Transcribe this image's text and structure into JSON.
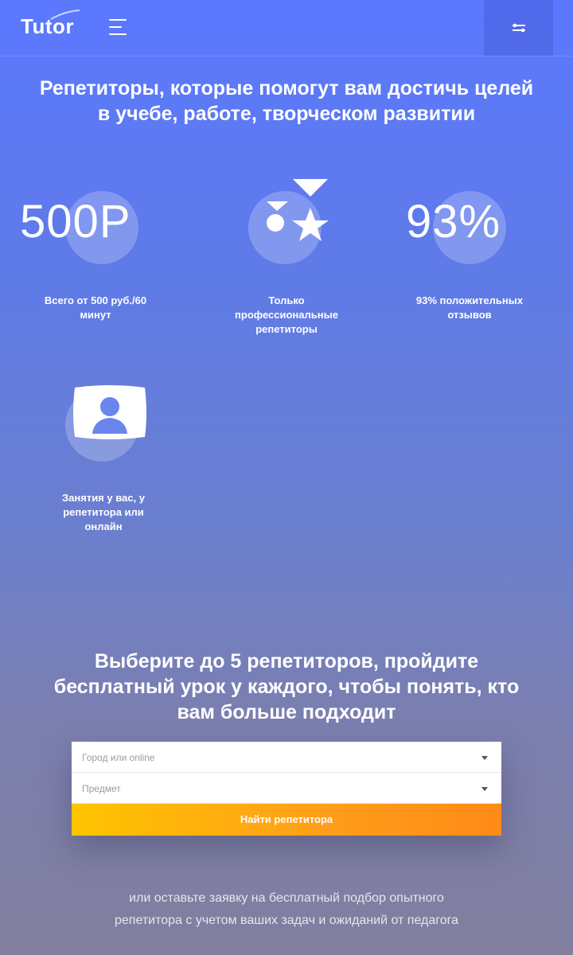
{
  "header": {
    "logo": "Tutor",
    "menu_icon": "hamburger-menu-icon",
    "filter_icon": "filter-sliders-icon"
  },
  "hero": {
    "title_line1": "Репетиторы, которые помогут вам достичь целей",
    "title_line2": "в учебе, работе, творческом развитии"
  },
  "features": [
    {
      "big": "500Р",
      "label_line1": "Всего от 500 руб./60",
      "label_line2": "минут"
    },
    {
      "icon": "medal-star-icon",
      "label_line1": "Только",
      "label_line2": "профессиональные",
      "label_line3": "репетиторы"
    },
    {
      "big": "93%",
      "label_line1": "93% положительных",
      "label_line2": "отзывов"
    },
    {
      "icon": "user-screen-icon",
      "label_line1": "Занятия у вас, у",
      "label_line2": "репетитора или",
      "label_line3": "онлайн"
    }
  ],
  "search": {
    "title_line1": "Выберите до 5 репетиторов, пройдите",
    "title_line2": "бесплатный урок у каждого, чтобы понять, кто",
    "title_line3": "вам больше подходит",
    "city_placeholder": "Город или online",
    "subject_placeholder": "Предмет",
    "button_label": "Найти репетитора"
  },
  "footer": {
    "line1": "или оставьте заявку на бесплатный подбор опытного",
    "line2": "репетитора с учетом ваших задач и ожиданий от педагога"
  },
  "colors": {
    "accent_orange": "#ff9d1a",
    "accent_yellow": "#ffc400",
    "brand_blue": "#5b78ff"
  }
}
